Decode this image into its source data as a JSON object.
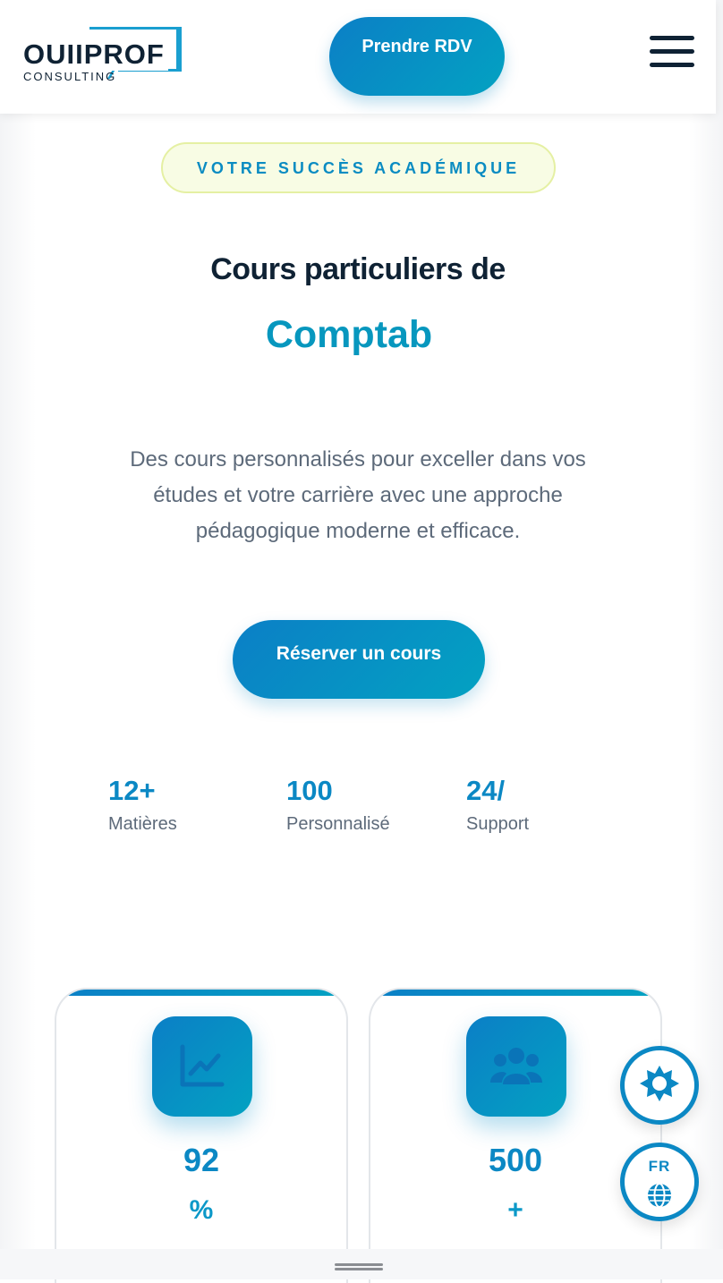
{
  "header": {
    "logo_main": "OUIIPROF",
    "logo_sub": "CONSULTING",
    "cta_label": "Prendre RDV",
    "menu_icon": "hamburger-menu-icon"
  },
  "hero": {
    "badge": "VOTRE SUCCÈS ACADÉMIQUE",
    "title": "Cours particuliers de",
    "subject": "Comptab",
    "description": "Des cours personnalisés pour exceller dans vos études et votre carrière avec une approche pédagogique moderne et efficace.",
    "cta_label": "Réserver un cours"
  },
  "stats": [
    {
      "value": "12+",
      "label": "Matières"
    },
    {
      "value": "100",
      "label": "Personnalisé"
    },
    {
      "value": "24/",
      "label": "Support"
    }
  ],
  "cards": [
    {
      "icon": "chart-line-icon",
      "value": "92",
      "unit": "%"
    },
    {
      "icon": "users-group-icon",
      "value": "500",
      "unit": "+"
    }
  ],
  "floating": {
    "theme_icon": "sun-icon",
    "language_label": "FR",
    "language_icon": "globe-icon"
  },
  "colors": {
    "primary": "#0b88c4",
    "gradient_start": "#0b7fc6",
    "gradient_end": "#03a2c2",
    "dark_text": "#0f2234",
    "badge_bg": "#f8fce4"
  }
}
